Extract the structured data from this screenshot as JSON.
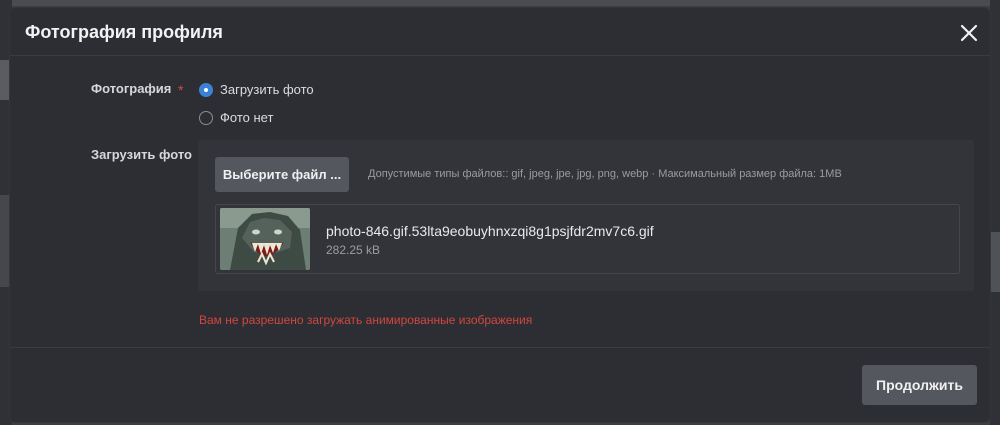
{
  "modal": {
    "title": "Фотография профиля",
    "close_icon": "close-icon"
  },
  "form": {
    "photo_label": "Фотография",
    "required_mark": "*",
    "radio_options": [
      {
        "label": "Загрузить фото",
        "checked": true
      },
      {
        "label": "Фото нет",
        "checked": false
      }
    ],
    "upload_label": "Загрузить фото",
    "choose_button": "Выберите файл ...",
    "file_hint": "Допустимые типы файлов:: gif, jpeg, jpe, jpg, png, webp · Максимальный размер файла: 1MB",
    "file": {
      "name": "photo-846.gif.53lta9eobuyhnxzqi8g1psjfdr2mv7c6.gif",
      "size": "282.25 kB"
    },
    "error": "Вам не разрешено загружать анимированные изображения"
  },
  "footer": {
    "continue_button": "Продолжить"
  },
  "colors": {
    "accent": "#3b82d6",
    "error": "#d2463f",
    "modal_bg": "#2c2e33",
    "button_bg": "#55575e"
  }
}
